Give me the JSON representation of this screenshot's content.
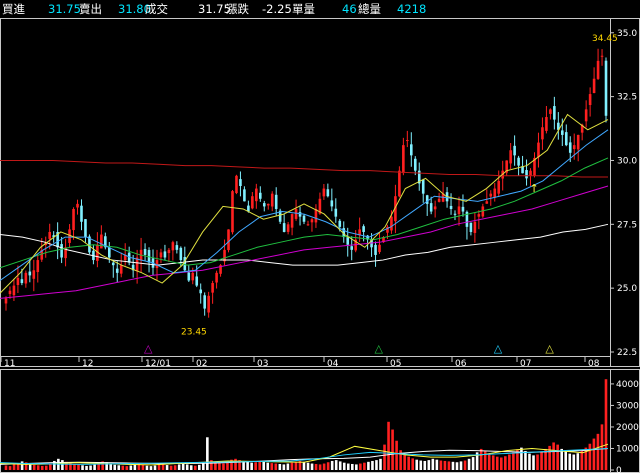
{
  "quote": {
    "bid_label": "買進",
    "bid_value": "31.75",
    "ask_label": "賣出",
    "ask_value": "31.80",
    "last_label": "成交",
    "last_value": "31.75",
    "change_label": "漲跌",
    "change_value": "-2.25",
    "unit_volume_label": "單量",
    "unit_volume_value": "46",
    "total_volume_label": "總量",
    "total_volume_value": "4218"
  },
  "colors": {
    "background": "#000000",
    "frame": "#c8c8c8",
    "up_candle": "#ff2020",
    "down_candle": "#80f0ff",
    "volume_up": "#ff2020",
    "volume_down": "#ffffff",
    "text": "#ffffff",
    "annotation": "#ffd700"
  },
  "chart_data": [
    {
      "type": "candlestick",
      "x_tick_labels": [
        "11",
        "12",
        "12/01",
        "02",
        "03",
        "04",
        "05",
        "06",
        "07",
        "08"
      ],
      "y_tick_labels": [
        "35.0",
        "32.5",
        "30.0",
        "27.5",
        "25.0",
        "22.5"
      ],
      "ylim": [
        22.5,
        35.5
      ],
      "annotations": {
        "high_label": "34.45",
        "low_label": "23.45"
      },
      "closes": [
        24.6,
        24.9,
        25.1,
        25.4,
        25.2,
        25.6,
        25.5,
        25.7,
        26.1,
        26.5,
        26.8,
        27.2,
        27.0,
        26.6,
        26.2,
        26.6,
        27.3,
        28.1,
        28.3,
        27.6,
        27.0,
        26.4,
        26.1,
        26.7,
        27.1,
        26.6,
        26.2,
        25.9,
        25.6,
        25.9,
        26.3,
        26.0,
        25.7,
        26.2,
        26.5,
        26.3,
        26.0,
        25.8,
        26.1,
        26.4,
        26.2,
        26.5,
        26.8,
        26.5,
        26.1,
        25.7,
        25.3,
        25.6,
        25.1,
        24.8,
        24.2,
        24.7,
        25.2,
        25.6,
        25.9,
        26.5,
        27.3,
        28.8,
        29.4,
        29.0,
        28.4,
        28.0,
        28.6,
        28.9,
        28.5,
        28.2,
        28.3,
        28.7,
        28.1,
        27.6,
        27.2,
        27.5,
        27.9,
        28.1,
        27.8,
        27.6,
        27.5,
        27.7,
        28.1,
        28.5,
        28.9,
        28.6,
        28.2,
        27.8,
        27.4,
        27.0,
        26.7,
        26.5,
        26.9,
        27.3,
        27.2,
        26.9,
        26.6,
        26.3,
        26.7,
        27.0,
        27.4,
        27.8,
        28.6,
        29.6,
        30.6,
        30.8,
        30.2,
        29.6,
        29.1,
        28.7,
        28.3,
        28.0,
        28.2,
        28.5,
        28.7,
        28.4,
        28.1,
        27.9,
        28.2,
        28.0,
        27.4,
        27.2,
        27.6,
        27.9,
        28.2,
        28.4,
        28.7,
        28.9,
        29.2,
        29.6,
        30.0,
        30.4,
        30.2,
        29.8,
        29.5,
        29.3,
        29.6,
        30.1,
        30.7,
        31.3,
        31.7,
        32.0,
        31.6,
        31.2,
        31.0,
        30.6,
        30.3,
        30.6,
        31.0,
        31.4,
        32.0,
        32.6,
        33.2,
        33.9,
        34.1,
        31.75
      ],
      "moving_averages": [
        {
          "color": "#ffffff",
          "values": [
            27.1,
            27.0,
            26.8,
            26.5,
            26.3,
            26.1,
            26.0,
            25.9,
            26.0,
            26.1,
            26.1,
            26.1,
            26.0,
            25.9,
            25.9,
            25.9,
            26.0,
            26.1,
            26.3,
            26.4,
            26.6,
            26.7,
            26.8,
            26.9,
            27.0,
            27.2,
            27.3,
            27.5
          ]
        },
        {
          "color": "#c01818",
          "values": [
            30.0,
            30.0,
            30.0,
            29.95,
            29.9,
            29.9,
            29.85,
            29.8,
            29.8,
            29.75,
            29.7,
            29.7,
            29.65,
            29.6,
            29.6,
            29.55,
            29.5,
            29.45,
            29.45,
            29.4,
            29.4,
            29.4,
            29.35,
            29.35
          ]
        },
        {
          "color": "#d000d0",
          "values": [
            24.6,
            24.7,
            24.8,
            24.9,
            25.1,
            25.3,
            25.5,
            25.6,
            25.7,
            25.9,
            26.1,
            26.3,
            26.5,
            26.6,
            26.7,
            26.8,
            27.0,
            27.2,
            27.5,
            27.7,
            27.9,
            28.1,
            28.4,
            28.7,
            29.0
          ]
        },
        {
          "color": "#20c040",
          "values": [
            25.8,
            26.1,
            26.4,
            26.6,
            26.7,
            26.6,
            26.3,
            26.1,
            25.9,
            26.0,
            26.3,
            26.6,
            26.8,
            27.0,
            27.1,
            27.0,
            26.9,
            27.1,
            27.4,
            27.7,
            27.9,
            28.1,
            28.4,
            28.8,
            29.2,
            29.7,
            30.1
          ]
        },
        {
          "color": "#40a8ff",
          "values": [
            25.3,
            25.9,
            26.5,
            27.0,
            27.0,
            26.6,
            26.2,
            26.0,
            25.6,
            25.7,
            26.4,
            27.2,
            27.8,
            28.0,
            27.9,
            27.6,
            27.2,
            27.0,
            27.4,
            28.0,
            28.6,
            28.5,
            28.4,
            28.6,
            28.8,
            29.2,
            29.9,
            30.6,
            31.2
          ]
        },
        {
          "color": "#e0e040",
          "values": [
            24.8,
            25.6,
            26.6,
            27.2,
            26.9,
            26.3,
            25.9,
            25.6,
            25.2,
            25.9,
            27.2,
            28.2,
            28.1,
            27.7,
            27.9,
            28.3,
            27.9,
            27.1,
            26.6,
            27.4,
            28.9,
            29.3,
            28.6,
            28.4,
            28.9,
            29.6,
            29.8,
            30.4,
            31.8,
            31.2,
            31.6
          ]
        }
      ],
      "markers": [
        {
          "label": "△",
          "color": "#c000c0",
          "index": 36
        },
        {
          "label": "△",
          "color": "#20c040",
          "index": 94
        },
        {
          "label": "△",
          "color": "#20d0ff",
          "index": 124
        },
        {
          "label": "△",
          "color": "#e0e040",
          "index": 137
        },
        {
          "label": "↑",
          "color": "#ffff40",
          "index": 133
        }
      ]
    },
    {
      "type": "bar",
      "y_tick_labels": [
        "4000",
        "3000",
        "2000",
        "1000",
        "0"
      ],
      "ylim": [
        0,
        4600
      ],
      "volumes": [
        210,
        180,
        260,
        320,
        400,
        360,
        280,
        240,
        220,
        190,
        200,
        260,
        420,
        520,
        460,
        380,
        300,
        260,
        240,
        220,
        190,
        210,
        250,
        320,
        400,
        360,
        280,
        240,
        220,
        200,
        180,
        210,
        260,
        300,
        240,
        200,
        180,
        210,
        240,
        260,
        230,
        200,
        220,
        260,
        300,
        260,
        220,
        200,
        240,
        320,
        1520,
        460,
        380,
        320,
        300,
        360,
        480,
        520,
        460,
        420,
        380,
        340,
        360,
        400,
        380,
        340,
        320,
        300,
        280,
        260,
        300,
        340,
        380,
        420,
        380,
        340,
        300,
        280,
        260,
        300,
        360,
        420,
        460,
        400,
        340,
        300,
        280,
        260,
        300,
        340,
        380,
        420,
        460,
        520,
        1180,
        2240,
        1880,
        1360,
        920,
        760,
        620,
        540,
        480,
        440,
        420,
        460,
        520,
        480,
        440,
        420,
        400,
        380,
        360,
        400,
        440,
        520,
        600,
        820,
        980,
        860,
        740,
        680,
        620,
        580,
        640,
        720,
        820,
        960,
        1040,
        880,
        760,
        680,
        720,
        860,
        980,
        1120,
        1280,
        1180,
        980,
        860,
        760,
        720,
        780,
        900,
        1040,
        1220,
        1460,
        1680,
        2120,
        4218
      ],
      "ma_lines": [
        {
          "color": "#ffffff",
          "values": [
            260,
            300,
            340,
            360,
            340,
            320,
            300,
            300,
            320,
            360,
            420,
            480,
            520,
            540,
            600,
            760,
            860,
            920,
            900,
            860,
            820,
            860,
            900,
            1000
          ]
        },
        {
          "color": "#ffff40",
          "values": [
            300,
            260,
            280,
            340,
            300,
            260,
            240,
            300,
            360,
            420,
            400,
            380,
            360,
            600,
            1100,
            900,
            700,
            600,
            600,
            700,
            900,
            1000,
            900,
            800,
            1200
          ]
        },
        {
          "color": "#20d0ff",
          "values": [
            340,
            300,
            280,
            260,
            280,
            300,
            320,
            340,
            360,
            380,
            400,
            420,
            520,
            700,
            820,
            760,
            700,
            680,
            700,
            760,
            820,
            880,
            940,
            1000
          ]
        }
      ]
    }
  ]
}
